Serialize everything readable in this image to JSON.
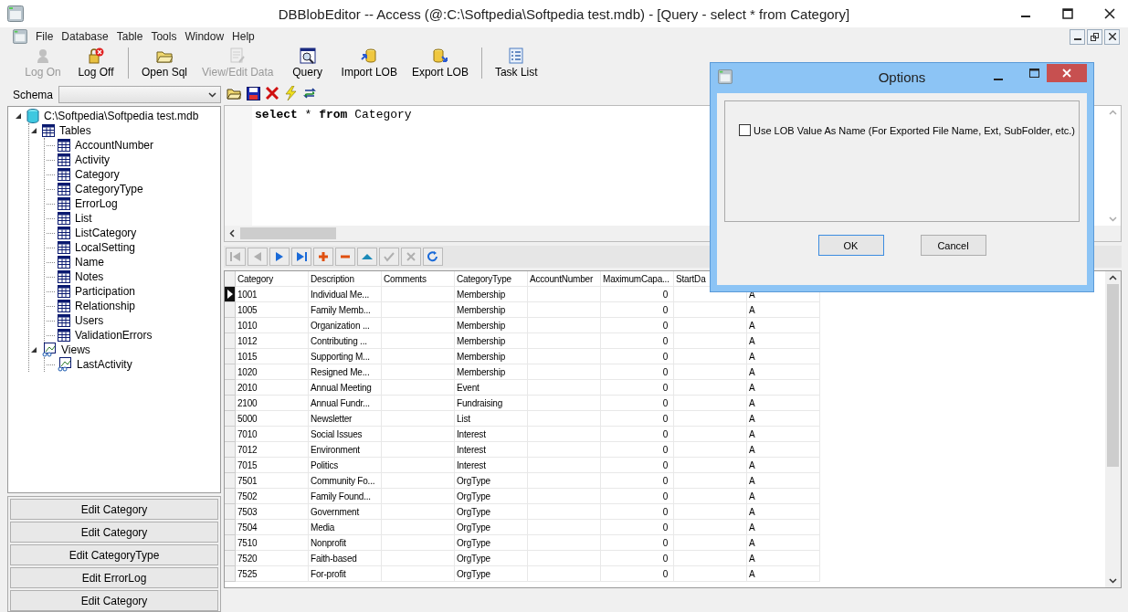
{
  "window": {
    "title": "DBBlobEditor -- Access (@:C:\\Softpedia\\Softpedia test.mdb) - [Query - select * from Category]"
  },
  "menu": [
    "File",
    "Database",
    "Table",
    "Tools",
    "Window",
    "Help"
  ],
  "toolbar": [
    {
      "label": "Log On",
      "disabled": true
    },
    {
      "label": "Log Off",
      "disabled": false
    },
    {
      "label": "Open Sql",
      "disabled": false
    },
    {
      "label": "View/Edit Data",
      "disabled": true
    },
    {
      "label": "Query",
      "disabled": false
    },
    {
      "label": "Import LOB",
      "disabled": false
    },
    {
      "label": "Export LOB",
      "disabled": false
    },
    {
      "label": "Task List",
      "disabled": false
    }
  ],
  "schema": {
    "label": "Schema"
  },
  "tree": {
    "label": "C:\\Softpedia\\Softpedia test.mdb",
    "kind": "database",
    "expanded": true,
    "children": [
      {
        "label": "Tables",
        "kind": "folder",
        "expanded": true,
        "children": [
          {
            "label": "AccountNumber",
            "kind": "table"
          },
          {
            "label": "Activity",
            "kind": "table"
          },
          {
            "label": "Category",
            "kind": "table"
          },
          {
            "label": "CategoryType",
            "kind": "table"
          },
          {
            "label": "ErrorLog",
            "kind": "table"
          },
          {
            "label": "List",
            "kind": "table"
          },
          {
            "label": "ListCategory",
            "kind": "table"
          },
          {
            "label": "LocalSetting",
            "kind": "table"
          },
          {
            "label": "Name",
            "kind": "table"
          },
          {
            "label": "Notes",
            "kind": "table"
          },
          {
            "label": "Participation",
            "kind": "table"
          },
          {
            "label": "Relationship",
            "kind": "table"
          },
          {
            "label": "Users",
            "kind": "table"
          },
          {
            "label": "ValidationErrors",
            "kind": "table"
          }
        ]
      },
      {
        "label": "Views",
        "kind": "views",
        "expanded": true,
        "children": [
          {
            "label": "LastActivity",
            "kind": "view"
          }
        ]
      }
    ]
  },
  "edit_buttons": [
    "Edit Category",
    "Edit Category",
    "Edit CategoryType",
    "Edit ErrorLog",
    "Edit Category"
  ],
  "query": {
    "text": "**select** * **from** Category"
  },
  "nav_buttons": [
    {
      "disabled": true
    },
    {
      "disabled": true
    },
    {
      "disabled": false
    },
    {
      "disabled": false
    },
    {
      "disabled": false
    },
    {
      "disabled": false
    },
    {
      "disabled": false
    },
    {
      "disabled": true
    },
    {
      "disabled": true
    },
    {
      "disabled": false
    }
  ],
  "grid": {
    "columns": [
      {
        "label": "Category",
        "kind": "text"
      },
      {
        "label": "Description",
        "kind": "text"
      },
      {
        "label": "Comments",
        "kind": "text"
      },
      {
        "label": "CategoryType",
        "kind": "text"
      },
      {
        "label": "AccountNumber",
        "kind": "text"
      },
      {
        "label": "MaximumCapa...",
        "kind": "number"
      },
      {
        "label": "StartDa",
        "kind": "text"
      }
    ],
    "rows": [
      {
        "selected": true,
        "cells": [
          "1001",
          "Individual Me...",
          null,
          "Membership",
          null,
          "0",
          null,
          "A"
        ]
      },
      {
        "selected": false,
        "cells": [
          "1005",
          "Family Memb...",
          null,
          "Membership",
          null,
          "0",
          null,
          "A"
        ]
      },
      {
        "selected": false,
        "cells": [
          "1010",
          "Organization ...",
          null,
          "Membership",
          null,
          "0",
          null,
          "A"
        ]
      },
      {
        "selected": false,
        "cells": [
          "1012",
          "Contributing ...",
          null,
          "Membership",
          null,
          "0",
          null,
          "A"
        ]
      },
      {
        "selected": false,
        "cells": [
          "1015",
          "Supporting M...",
          null,
          "Membership",
          null,
          "0",
          null,
          "A"
        ]
      },
      {
        "selected": false,
        "cells": [
          "1020",
          "Resigned Me...",
          null,
          "Membership",
          null,
          "0",
          null,
          "A"
        ]
      },
      {
        "selected": false,
        "cells": [
          "2010",
          "Annual Meeting",
          null,
          "Event",
          null,
          "0",
          null,
          "A"
        ]
      },
      {
        "selected": false,
        "cells": [
          "2100",
          "Annual Fundr...",
          null,
          "Fundraising",
          null,
          "0",
          null,
          "A"
        ]
      },
      {
        "selected": false,
        "cells": [
          "5000",
          "Newsletter",
          null,
          "List",
          null,
          "0",
          null,
          "A"
        ]
      },
      {
        "selected": false,
        "cells": [
          "7010",
          "Social Issues",
          null,
          "Interest",
          null,
          "0",
          null,
          "A"
        ]
      },
      {
        "selected": false,
        "cells": [
          "7012",
          "Environment",
          null,
          "Interest",
          null,
          "0",
          null,
          "A"
        ]
      },
      {
        "selected": false,
        "cells": [
          "7015",
          "Politics",
          null,
          "Interest",
          null,
          "0",
          null,
          "A"
        ]
      },
      {
        "selected": false,
        "cells": [
          "7501",
          "Community Fo...",
          null,
          "OrgType",
          null,
          "0",
          null,
          "A"
        ]
      },
      {
        "selected": false,
        "cells": [
          "7502",
          "Family Found...",
          null,
          "OrgType",
          null,
          "0",
          null,
          "A"
        ]
      },
      {
        "selected": false,
        "cells": [
          "7503",
          "Government",
          null,
          "OrgType",
          null,
          "0",
          null,
          "A"
        ]
      },
      {
        "selected": false,
        "cells": [
          "7504",
          "Media",
          null,
          "OrgType",
          null,
          "0",
          null,
          "A"
        ]
      },
      {
        "selected": false,
        "cells": [
          "7510",
          "Nonprofit",
          null,
          "OrgType",
          null,
          "0",
          null,
          "A"
        ]
      },
      {
        "selected": false,
        "cells": [
          "7520",
          "Faith-based",
          null,
          "OrgType",
          null,
          "0",
          null,
          "A"
        ]
      },
      {
        "selected": false,
        "cells": [
          "7525",
          "For-profit",
          null,
          "OrgType",
          null,
          "0",
          null,
          "A"
        ]
      }
    ]
  },
  "dialog": {
    "title": "Options",
    "checkbox": {
      "label": "Use LOB Value As Name (For Exported File Name, Ext, SubFolder, etc.)",
      "checked": false
    },
    "buttons": [
      {
        "label": "OK",
        "default": true
      },
      {
        "label": "Cancel",
        "default": false
      }
    ]
  }
}
